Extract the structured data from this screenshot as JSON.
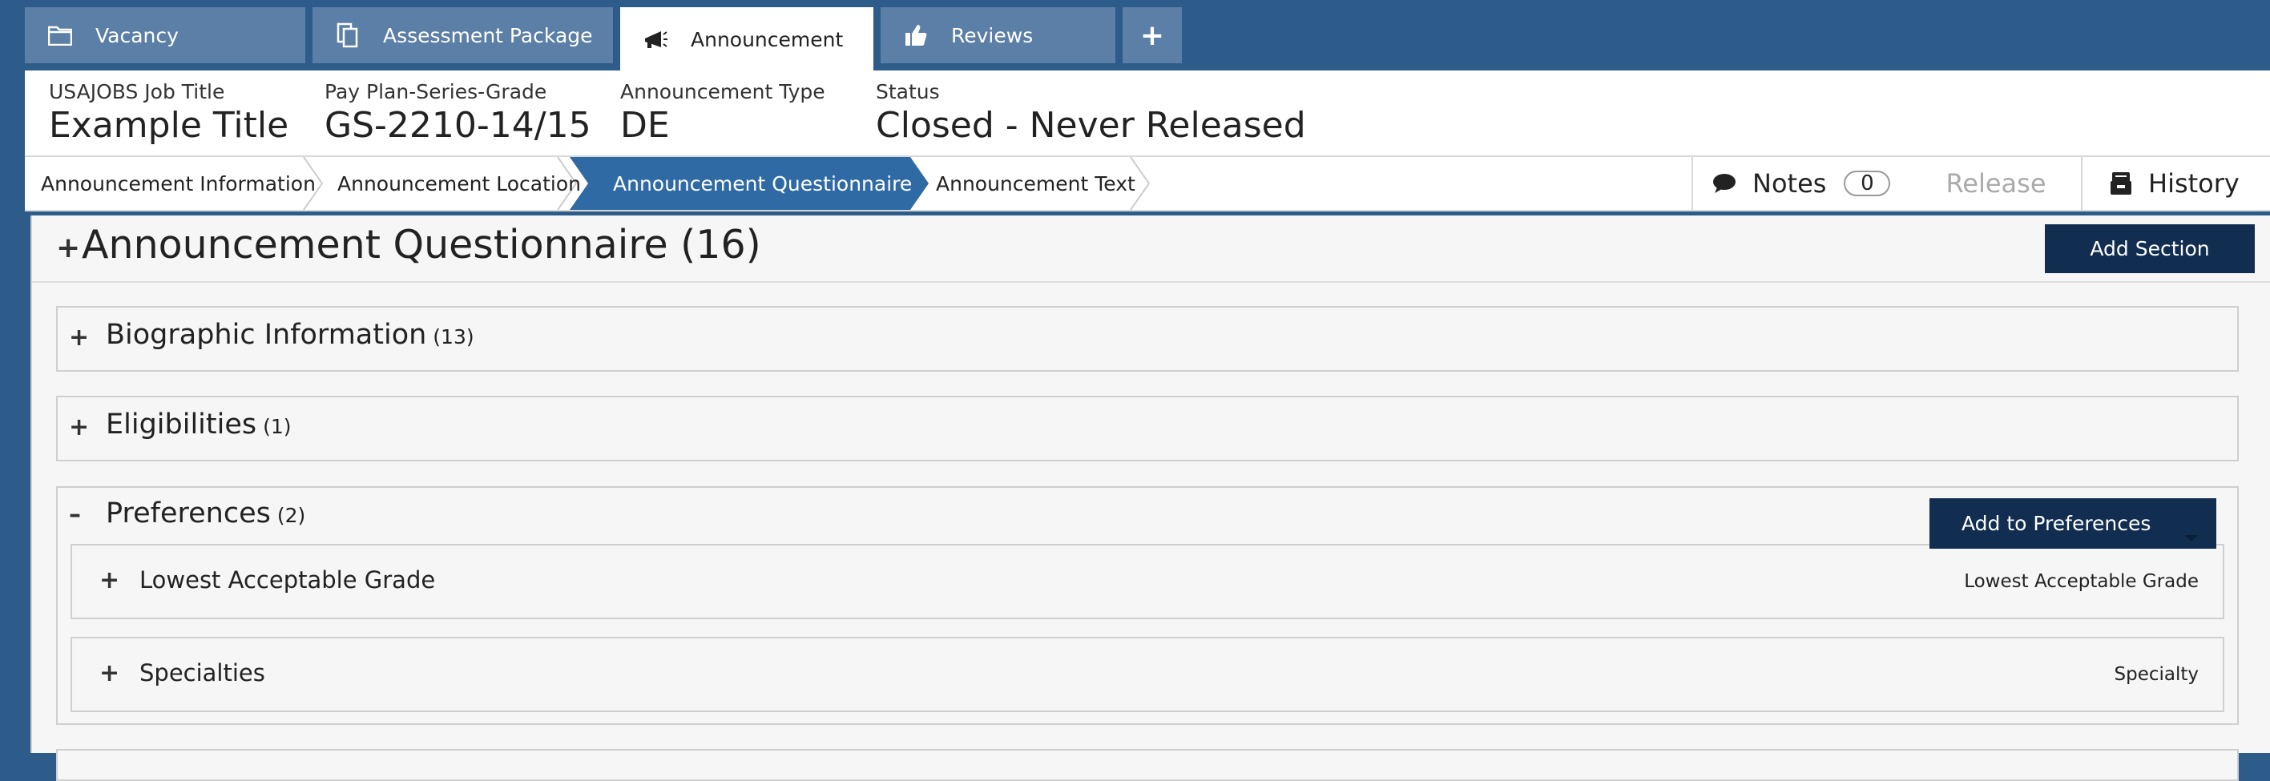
{
  "tabs": [
    {
      "label": "Vacancy",
      "icon": "folder-icon"
    },
    {
      "label": "Assessment Package",
      "icon": "documents-icon"
    },
    {
      "label": "Announcement",
      "icon": "megaphone-icon"
    },
    {
      "label": "Reviews",
      "icon": "thumbs-up-icon"
    },
    {
      "label": "+",
      "icon": "plus-icon"
    }
  ],
  "header": {
    "job_title_label": "USAJOBS Job Title",
    "job_title": "Example Title",
    "grade_label": "Pay Plan-Series-Grade",
    "grade": "GS-2210-14/15",
    "type_label": "Announcement Type",
    "type": "DE",
    "status_label": "Status",
    "status": "Closed - Never Released"
  },
  "subnav": {
    "crumbs": [
      "Announcement Information",
      "Announcement Location",
      "Announcement Questionnaire",
      "Announcement Text"
    ],
    "notes_label": "Notes",
    "notes_count": "0",
    "release_label": "Release",
    "history_label": "History"
  },
  "questionnaire": {
    "title": "Announcement Questionnaire (16)",
    "add_section_label": "Add Section",
    "sections": [
      {
        "name": "Biographic Information",
        "count": "(13)",
        "toggle": "+"
      },
      {
        "name": "Eligibilities",
        "count": "(1)",
        "toggle": "+"
      },
      {
        "name": "Preferences",
        "count": "(2)",
        "toggle": "–"
      }
    ],
    "add_to_preferences_label": "Add to Preferences",
    "preferences_items": [
      {
        "name": "Lowest Acceptable Grade",
        "tag": "Lowest Acceptable Grade"
      },
      {
        "name": "Specialties",
        "tag": "Specialty"
      }
    ]
  },
  "colors": {
    "background": "#2d5b8a",
    "tab_inactive": "#5b7fa6",
    "crumb_active": "#2f6aa5",
    "dark_button": "#112e51"
  }
}
